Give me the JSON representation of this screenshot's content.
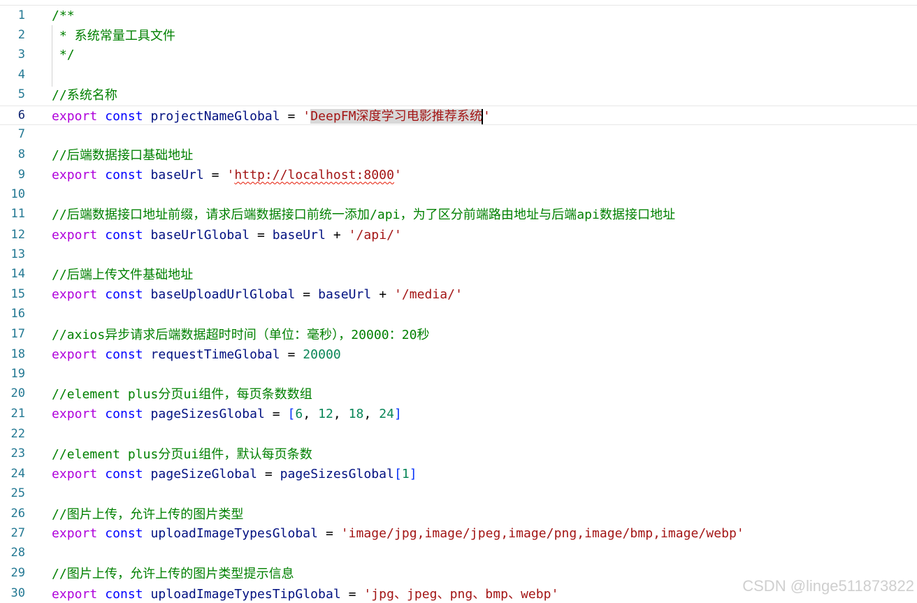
{
  "editor": {
    "lines": {
      "l1": {
        "num": "1",
        "t": "/**"
      },
      "l2": {
        "num": "2",
        "t": " * 系统常量工具文件"
      },
      "l3": {
        "num": "3",
        "t": " */"
      },
      "l4": {
        "num": "4"
      },
      "l5": {
        "num": "5",
        "t": "//系统名称"
      },
      "l6": {
        "num": "6",
        "name": "projectNameGlobal",
        "q1": "'",
        "val": "DeepFM深度学习电影推荐系统",
        "q2": "'"
      },
      "l7": {
        "num": "7"
      },
      "l8": {
        "num": "8",
        "t": "//后端数据接口基础地址"
      },
      "l9": {
        "num": "9",
        "name": "baseUrl",
        "q1": "'",
        "val": "http://localhost:8000",
        "q2": "'"
      },
      "l10": {
        "num": "10"
      },
      "l11": {
        "num": "11",
        "t": "//后端数据接口地址前缀，请求后端数据接口前统一添加/api，为了区分前端路由地址与后端api数据接口地址"
      },
      "l12": {
        "num": "12",
        "name": "baseUrlGlobal",
        "ref": "baseUrl",
        "plus": "+",
        "s": "'/api/'"
      },
      "l13": {
        "num": "13"
      },
      "l14": {
        "num": "14",
        "t": "//后端上传文件基础地址"
      },
      "l15": {
        "num": "15",
        "name": "baseUploadUrlGlobal",
        "ref": "baseUrl",
        "plus": "+",
        "s": "'/media/'"
      },
      "l16": {
        "num": "16"
      },
      "l17": {
        "num": "17",
        "t": "//axios异步请求后端数据超时时间（单位：毫秒），20000：20秒"
      },
      "l18": {
        "num": "18",
        "name": "requestTimeGlobal",
        "n": "20000"
      },
      "l19": {
        "num": "19"
      },
      "l20": {
        "num": "20",
        "t": "//element plus分页ui组件，每页条数数组"
      },
      "l21": {
        "num": "21",
        "name": "pageSizesGlobal",
        "ob": "[",
        "n1": "6",
        "c1": ", ",
        "n2": "12",
        "c2": ", ",
        "n3": "18",
        "c3": ", ",
        "n4": "24",
        "cb": "]"
      },
      "l22": {
        "num": "22"
      },
      "l23": {
        "num": "23",
        "t": "//element plus分页ui组件，默认每页条数"
      },
      "l24": {
        "num": "24",
        "name": "pageSizeGlobal",
        "ref": "pageSizesGlobal",
        "ob": "[",
        "n1": "1",
        "cb": "]"
      },
      "l25": {
        "num": "25"
      },
      "l26": {
        "num": "26",
        "t": "//图片上传，允许上传的图片类型"
      },
      "l27": {
        "num": "27",
        "name": "uploadImageTypesGlobal",
        "s": "'image/jpg,image/jpeg,image/png,image/bmp,image/webp'"
      },
      "l28": {
        "num": "28"
      },
      "l29": {
        "num": "29",
        "t": "//图片上传，允许上传的图片类型提示信息"
      },
      "l30": {
        "num": "30",
        "name": "uploadImageTypesTipGlobal",
        "s": "'jpg、jpeg、png、bmp、webp'"
      }
    },
    "kw_export": "export",
    "kw_const": "const",
    "assign": "="
  },
  "watermark": "CSDN @linge511873822",
  "colors": {
    "comment": "#008000",
    "keyword_export": "#af00db",
    "keyword_const": "#0000ff",
    "identifier": "#001080",
    "string": "#a31515",
    "number": "#098658",
    "line_number": "#237893"
  }
}
